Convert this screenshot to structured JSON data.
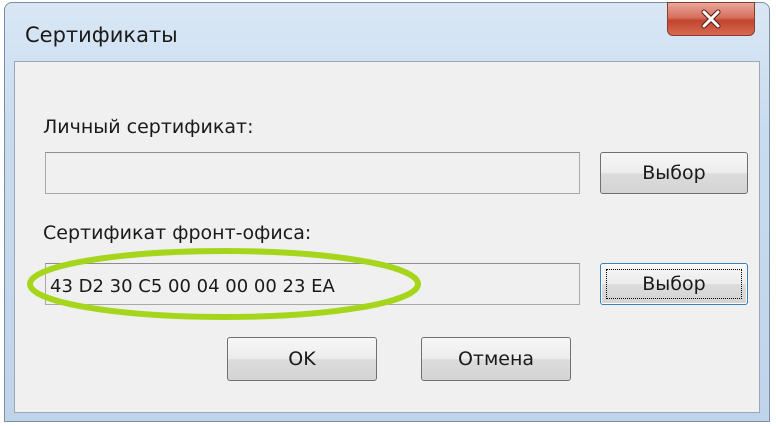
{
  "window": {
    "title": "Сертификаты"
  },
  "personal_certificate": {
    "label": "Личный сертификат:",
    "value": "",
    "select_label": "Выбор"
  },
  "front_office_certificate": {
    "label": "Сертификат фронт-офиса:",
    "value": "43 D2 30 C5 00 04 00 00 23 EA",
    "select_label": "Выбор"
  },
  "buttons": {
    "ok_label": "OK",
    "cancel_label": "Отмена"
  },
  "icons": {
    "close": "close-icon"
  },
  "colors": {
    "close_button": "#c9523c",
    "highlight": "#a6d61c"
  }
}
